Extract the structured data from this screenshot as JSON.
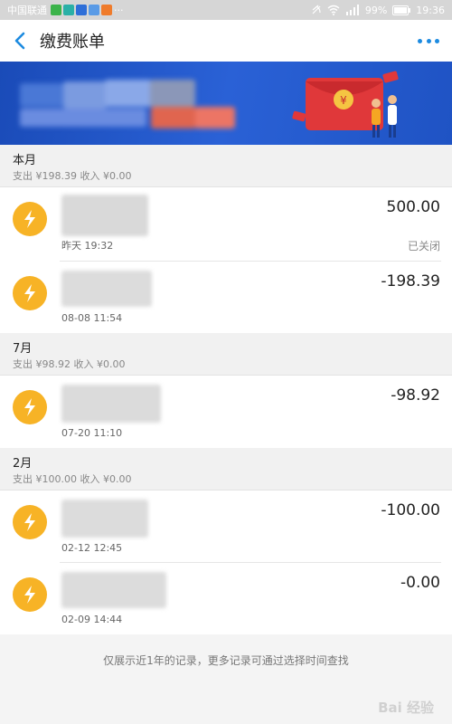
{
  "status_bar": {
    "carrier": "中国联通",
    "overflow": "···",
    "battery": "99%",
    "time": "19:36"
  },
  "nav": {
    "title": "缴费账单"
  },
  "banner": {
    "currency_symbol": "¥"
  },
  "sections": [
    {
      "title": "本月",
      "summary": "支出 ¥198.39    收入 ¥0.00",
      "records": [
        {
          "time": "昨天  19:32",
          "amount": "500.00",
          "status": "已关闭"
        },
        {
          "time": "08-08  11:54",
          "amount": "-198.39"
        }
      ]
    },
    {
      "title": "7月",
      "summary": "支出 ¥98.92    收入 ¥0.00",
      "records": [
        {
          "time": "07-20  11:10",
          "amount": "-98.92"
        }
      ]
    },
    {
      "title": "2月",
      "summary": "支出 ¥100.00    收入 ¥0.00",
      "records": [
        {
          "time": "02-12  12:45",
          "amount": "-100.00"
        },
        {
          "time": "02-09  14:44",
          "amount": "-0.00"
        }
      ]
    }
  ],
  "footer": {
    "note": "仅展示近1年的记录，更多记录可通过选择时间查找",
    "watermark": "Bai 经验"
  },
  "colors": {
    "accent": "#1d8be0",
    "bolt": "#f7b326",
    "banner": "#2a61d6",
    "red_envelope": "#e0383a"
  },
  "icons": {
    "back": "chevron-left-icon",
    "more": "more-dots-icon",
    "record": "lightning-bolt-icon"
  }
}
